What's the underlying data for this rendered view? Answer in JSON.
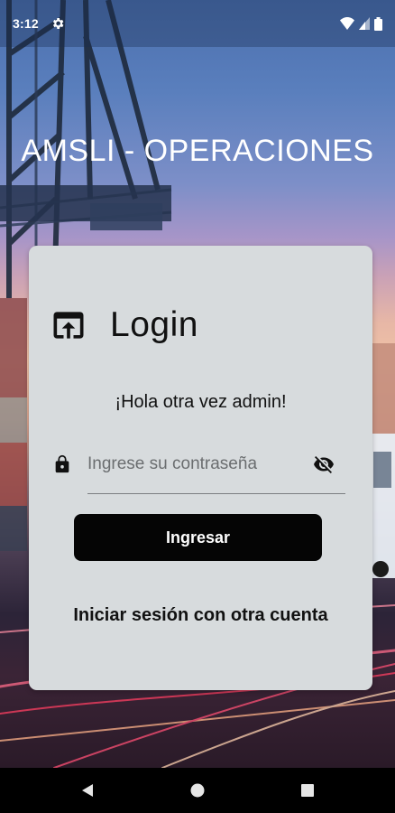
{
  "status_bar": {
    "time": "3:12",
    "icons": [
      "gear-icon",
      "wifi-icon",
      "cell-signal-icon",
      "battery-icon"
    ]
  },
  "app": {
    "title": "AMSLI - OPERACIONES"
  },
  "login": {
    "title": "Login",
    "icon": "open-in-browser-icon",
    "greeting": "¡Hola otra vez admin!",
    "password": {
      "value": "",
      "placeholder": "Ingrese su contraseña",
      "leading_icon": "lock-icon",
      "trailing_icon": "visibility-off-icon"
    },
    "submit_label": "Ingresar",
    "other_account_label": "Iniciar sesión con otra cuenta"
  },
  "nav_bar": {
    "icons": [
      "back-icon",
      "home-icon",
      "recents-icon"
    ]
  },
  "colors": {
    "card_background": "#d7dbdd",
    "button_background": "#050505",
    "button_text": "#ffffff",
    "title_text": "#ffffff",
    "text": "#111111"
  }
}
